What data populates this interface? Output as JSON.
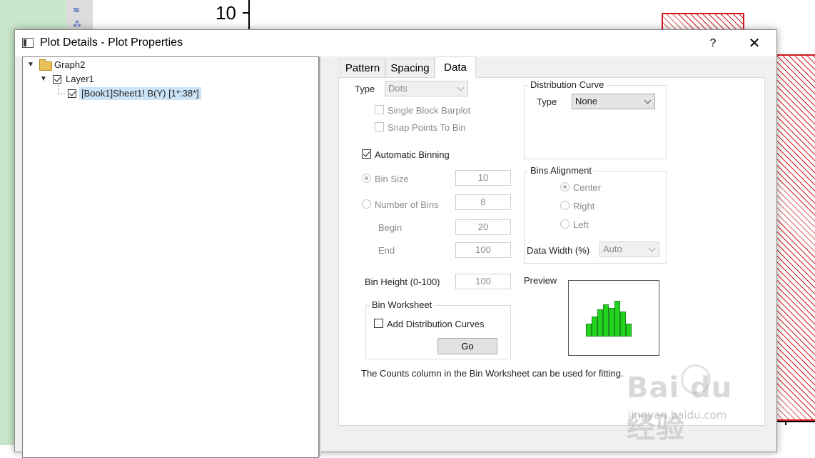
{
  "background": {
    "axis_tick_label": "10"
  },
  "dialog": {
    "title": "Plot Details - Plot Properties",
    "help_label": "?",
    "close_label": "✕"
  },
  "tree": {
    "root": "Graph2",
    "layer": "Layer1",
    "plot": "[Book1]Sheet1! B(Y) [1*:38*]"
  },
  "tabs": [
    {
      "label": "Pattern",
      "active": false
    },
    {
      "label": "Spacing",
      "active": false
    },
    {
      "label": "Data",
      "active": true
    }
  ],
  "data_tab": {
    "type_label": "Type",
    "type_value": "Dots",
    "single_block_barplot": "Single Block Barplot",
    "snap_points_to_bin": "Snap Points To Bin",
    "automatic_binning": "Automatic Binning",
    "bin_size_label": "Bin Size",
    "bin_size_value": "10",
    "number_of_bins_label": "Number of Bins",
    "number_of_bins_value": "8",
    "begin_label": "Begin",
    "begin_value": "20",
    "end_label": "End",
    "end_value": "100",
    "bin_height_label": "Bin Height (0-100)",
    "bin_height_value": "100",
    "bin_worksheet_title": "Bin Worksheet",
    "add_distribution_curves": "Add Distribution Curves",
    "go_label": "Go",
    "distribution_curve_title": "Distribution Curve",
    "dist_type_label": "Type",
    "dist_type_value": "None",
    "bins_alignment_title": "Bins Alignment",
    "align_center": "Center",
    "align_right": "Right",
    "align_left": "Left",
    "data_width_label": "Data Width (%)",
    "data_width_value": "Auto",
    "preview_label": "Preview",
    "preview_bars": [
      0.35,
      0.55,
      0.75,
      0.9,
      0.8,
      1.0,
      0.7,
      0.35
    ],
    "note": "The Counts column in the Bin Worksheet can be used for fitting."
  },
  "watermark": {
    "logo": "Bai du 经验",
    "url": "jingyan.baidu.com"
  },
  "colors": {
    "hatch": "#d21b1b",
    "preview_bar": "#22d41e",
    "selection": "#cce4f7"
  }
}
